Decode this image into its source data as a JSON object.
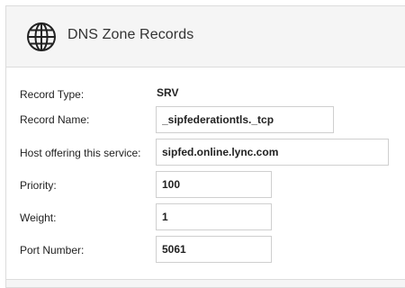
{
  "panel": {
    "title": "DNS Zone Records",
    "icon": "globe-icon"
  },
  "form": {
    "record_type": {
      "label": "Record Type:",
      "value": "SRV"
    },
    "record_name": {
      "label": "Record Name:",
      "value": "_sipfederationtls._tcp"
    },
    "host": {
      "label": "Host offering this service:",
      "value": "sipfed.online.lync.com"
    },
    "priority": {
      "label": "Priority:",
      "value": "100"
    },
    "weight": {
      "label": "Weight:",
      "value": "1"
    },
    "port": {
      "label": "Port Number:",
      "value": "5061"
    }
  }
}
